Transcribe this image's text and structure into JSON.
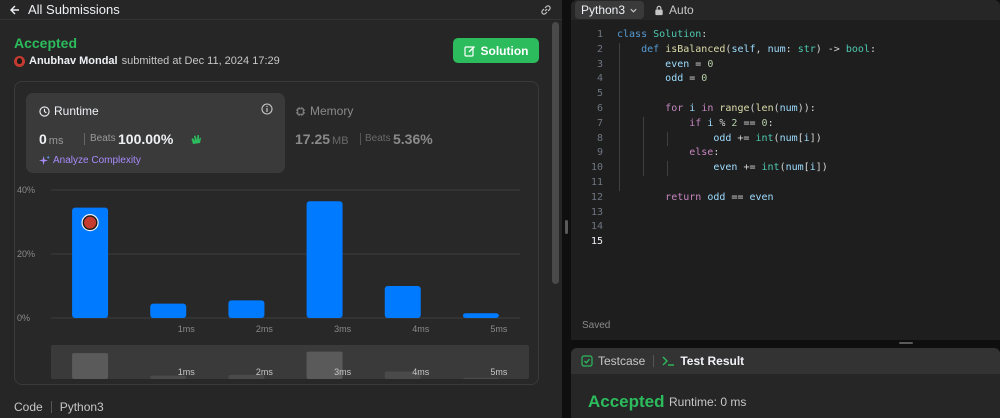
{
  "left": {
    "header_title": "All Submissions",
    "status": "Accepted",
    "submitter": {
      "name": "Anubhav Mondal",
      "submitted_prefix": "submitted at",
      "submitted_time": "Dec 11, 2024 17:29"
    },
    "solution_button": "Solution",
    "runtime": {
      "label": "Runtime",
      "value": "0",
      "unit": "ms",
      "beats_label": "Beats",
      "beats_value": "100.00%",
      "analyze": "Analyze Complexity"
    },
    "memory": {
      "label": "Memory",
      "value": "17.25",
      "unit": "MB",
      "beats_label": "Beats",
      "beats_value": "5.36%"
    },
    "code_label": "Code",
    "code_lang": "Python3"
  },
  "chart_data": {
    "type": "bar",
    "categories": [
      "0ms",
      "1ms",
      "2ms",
      "3ms",
      "4ms",
      "5ms"
    ],
    "x_tick_labels": [
      "",
      "1ms",
      "2ms",
      "3ms",
      "4ms",
      "5ms"
    ],
    "values": [
      34.5,
      4.5,
      5.5,
      36.5,
      10,
      1.5
    ],
    "y_tick_labels": [
      "0%",
      "20%",
      "40%"
    ],
    "ylim": [
      0,
      40
    ],
    "highlight_index": 0,
    "grid": true,
    "overview_tick_labels": [
      "1ms",
      "2ms",
      "3ms",
      "4ms",
      "5ms"
    ],
    "colors": {
      "bar": "#007aff",
      "grid": "#3e3e3e",
      "tick": "#8a8a8a",
      "avatar": "#c53b30"
    }
  },
  "editor": {
    "language": "Python3",
    "mode": "Auto",
    "saved": "Saved",
    "active_line": 15,
    "lines": [
      {
        "n": "1",
        "tokens": [
          [
            "kw",
            "class "
          ],
          [
            "cls",
            "Solution"
          ],
          [
            "plain",
            ":"
          ]
        ]
      },
      {
        "n": "2",
        "tokens": [
          [
            "plain",
            "    "
          ],
          [
            "kw",
            "def "
          ],
          [
            "fn",
            "isBalanced"
          ],
          [
            "plain",
            "("
          ],
          [
            "var",
            "self"
          ],
          [
            "plain",
            ", "
          ],
          [
            "var",
            "num"
          ],
          [
            "plain",
            ": "
          ],
          [
            "cls",
            "str"
          ],
          [
            "plain",
            ") -> "
          ],
          [
            "cls",
            "bool"
          ],
          [
            "plain",
            ":"
          ]
        ]
      },
      {
        "n": "3",
        "tokens": [
          [
            "plain",
            "        "
          ],
          [
            "var",
            "even"
          ],
          [
            "plain",
            " = "
          ],
          [
            "num",
            "0"
          ]
        ]
      },
      {
        "n": "4",
        "tokens": [
          [
            "plain",
            "        "
          ],
          [
            "var",
            "odd"
          ],
          [
            "plain",
            " = "
          ],
          [
            "num",
            "0"
          ]
        ]
      },
      {
        "n": "5",
        "tokens": []
      },
      {
        "n": "6",
        "tokens": [
          [
            "plain",
            "        "
          ],
          [
            "ctl",
            "for "
          ],
          [
            "var",
            "i"
          ],
          [
            "ctl",
            " in "
          ],
          [
            "fn",
            "range"
          ],
          [
            "plain",
            "("
          ],
          [
            "fn",
            "len"
          ],
          [
            "plain",
            "("
          ],
          [
            "var",
            "num"
          ],
          [
            "plain",
            ")):"
          ]
        ]
      },
      {
        "n": "7",
        "tokens": [
          [
            "plain",
            "            "
          ],
          [
            "ctl",
            "if "
          ],
          [
            "var",
            "i"
          ],
          [
            "plain",
            " % "
          ],
          [
            "num",
            "2"
          ],
          [
            "plain",
            " == "
          ],
          [
            "num",
            "0"
          ],
          [
            "plain",
            ":"
          ]
        ]
      },
      {
        "n": "8",
        "tokens": [
          [
            "plain",
            "                "
          ],
          [
            "var",
            "odd"
          ],
          [
            "plain",
            " += "
          ],
          [
            "cls",
            "int"
          ],
          [
            "plain",
            "("
          ],
          [
            "var",
            "num"
          ],
          [
            "plain",
            "["
          ],
          [
            "var",
            "i"
          ],
          [
            "plain",
            "])"
          ]
        ]
      },
      {
        "n": "9",
        "tokens": [
          [
            "plain",
            "            "
          ],
          [
            "ctl",
            "else"
          ],
          [
            "plain",
            ":"
          ]
        ]
      },
      {
        "n": "10",
        "tokens": [
          [
            "plain",
            "                "
          ],
          [
            "var",
            "even"
          ],
          [
            "plain",
            " += "
          ],
          [
            "cls",
            "int"
          ],
          [
            "plain",
            "("
          ],
          [
            "var",
            "num"
          ],
          [
            "plain",
            "["
          ],
          [
            "var",
            "i"
          ],
          [
            "plain",
            "])"
          ]
        ]
      },
      {
        "n": "11",
        "tokens": []
      },
      {
        "n": "12",
        "tokens": [
          [
            "plain",
            "        "
          ],
          [
            "ctl",
            "return "
          ],
          [
            "var",
            "odd"
          ],
          [
            "plain",
            " == "
          ],
          [
            "var",
            "even"
          ]
        ]
      },
      {
        "n": "13",
        "tokens": []
      },
      {
        "n": "14",
        "tokens": []
      },
      {
        "n": "15",
        "tokens": []
      }
    ]
  },
  "testpanel": {
    "tab_testcase": "Testcase",
    "tab_result": "Test Result",
    "result_status": "Accepted",
    "result_runtime": "Runtime: 0 ms"
  }
}
